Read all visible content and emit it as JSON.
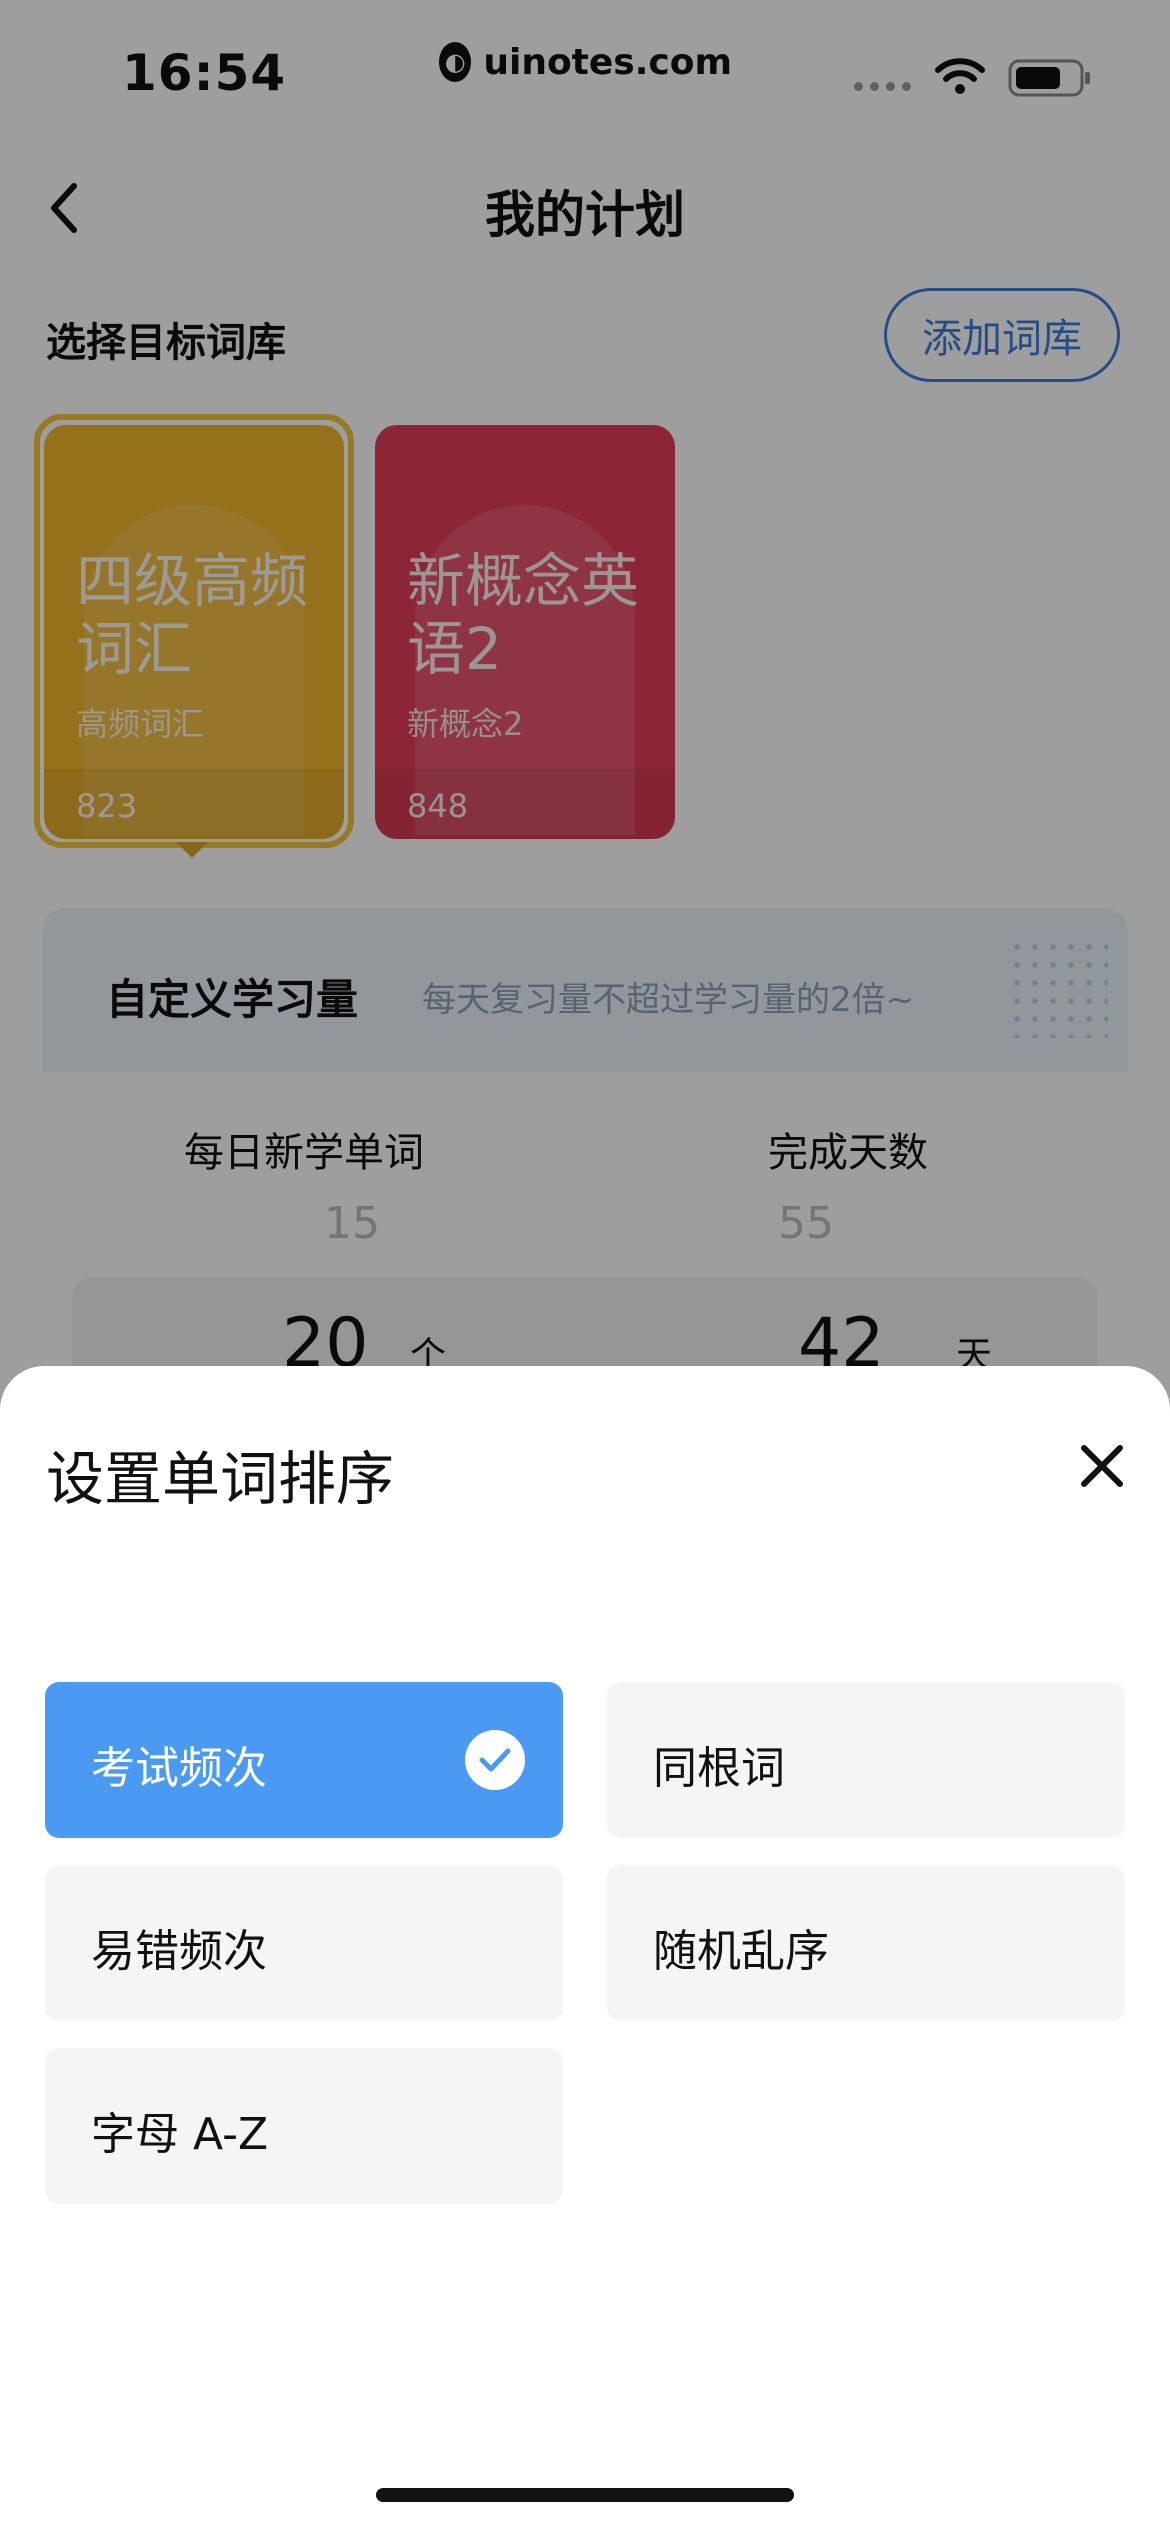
{
  "status_bar": {
    "time": "16:54",
    "watermark": "uinotes.com",
    "icons": [
      "signal-dots-icon",
      "wifi-icon",
      "battery-icon"
    ]
  },
  "nav": {
    "title": "我的计划",
    "back_icon": "chevron-left-icon"
  },
  "library": {
    "section_label": "选择目标词库",
    "add_button": "添加词库",
    "cards": [
      {
        "title": "四级高频词汇",
        "subtitle": "高频词汇",
        "count": "823",
        "color": "#f2b72c",
        "selected": true
      },
      {
        "title": "新概念英语2",
        "subtitle": "新概念2",
        "count": "848",
        "color": "#e33d57",
        "selected": false
      }
    ]
  },
  "study": {
    "title": "自定义学习量",
    "hint": "每天复习量不超过学习量的2倍~",
    "daily_label": "每日新学单词",
    "days_label": "完成天数",
    "daily_prev": "15",
    "daily_value": "20",
    "daily_unit": "个",
    "days_prev": "55",
    "days_value": "42",
    "days_unit": "天"
  },
  "sheet": {
    "title": "设置单词排序",
    "close_icon": "close-icon",
    "options": [
      {
        "label": "考试频次",
        "selected": true
      },
      {
        "label": "同根词",
        "selected": false
      },
      {
        "label": "易错频次",
        "selected": false
      },
      {
        "label": "随机乱序",
        "selected": false
      },
      {
        "label": "字母 A-Z",
        "selected": false
      }
    ]
  },
  "colors": {
    "accent": "#4a9af3",
    "link_blue": "#3b7dd8",
    "overlay": "rgba(0,0,0,0.38)"
  }
}
